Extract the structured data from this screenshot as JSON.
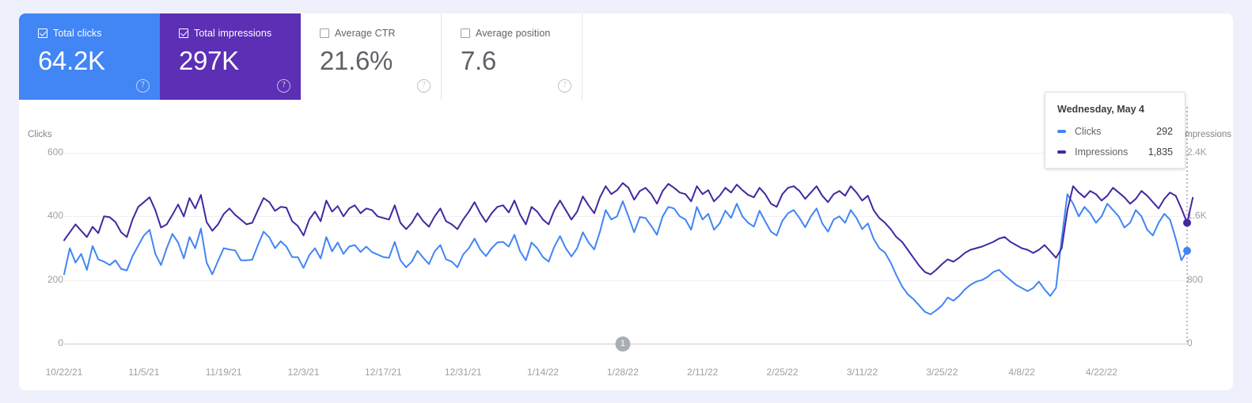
{
  "metrics": [
    {
      "id": "total-clicks",
      "label": "Total clicks",
      "value": "64.2K",
      "checked": true,
      "selected": "clicks",
      "help": "?"
    },
    {
      "id": "total-impressions",
      "label": "Total impressions",
      "value": "297K",
      "checked": true,
      "selected": "impr",
      "help": "?"
    },
    {
      "id": "average-ctr",
      "label": "Average CTR",
      "value": "21.6%",
      "checked": false,
      "selected": "",
      "help": "?"
    },
    {
      "id": "average-position",
      "label": "Average position",
      "value": "7.6",
      "checked": false,
      "selected": "",
      "help": "?"
    }
  ],
  "tooltip": {
    "title": "Wednesday, May 4",
    "rows": [
      {
        "name": "Clicks",
        "value": "292",
        "color": "#4285f4"
      },
      {
        "name": "Impressions",
        "value": "1,835",
        "color": "#4527a0"
      }
    ]
  },
  "colors": {
    "clicks": "#4285f4",
    "impressions": "#4527a0",
    "card_bg": "#ffffff",
    "page_bg": "#eef1fb",
    "grid": "#f0f0f2",
    "axis_text": "#9aa0a6"
  },
  "annotation": {
    "label": "1",
    "x_index": 98
  },
  "chart_data": {
    "type": "line",
    "title": "",
    "xlabel": "",
    "grid": true,
    "legend": "tooltip",
    "axes": {
      "left": {
        "label": "Clicks",
        "ticks": [
          "600",
          "400",
          "200",
          "0"
        ],
        "range": [
          0,
          600
        ]
      },
      "right": {
        "label": "Impressions",
        "ticks": [
          "2.4K",
          "1.6K",
          "800",
          "0"
        ],
        "range": [
          0,
          2400
        ]
      }
    },
    "x_tick_labels": [
      "10/22/21",
      "11/5/21",
      "11/19/21",
      "12/3/21",
      "12/17/21",
      "12/31/21",
      "1/14/22",
      "1/28/22",
      "2/11/22",
      "2/25/22",
      "3/11/22",
      "3/25/22",
      "4/8/22",
      "4/22/22"
    ],
    "x_tick_interval_days": 14,
    "x_start": "10/22/21",
    "x_end": "5/4/22",
    "n_points": 195,
    "series": [
      {
        "name": "Clicks",
        "axis": "left",
        "color": "#4285f4",
        "values": [
          218,
          300,
          255,
          282,
          232,
          307,
          265,
          258,
          247,
          262,
          235,
          230,
          275,
          308,
          340,
          358,
          282,
          247,
          300,
          345,
          318,
          268,
          335,
          300,
          362,
          255,
          218,
          260,
          300,
          296,
          293,
          262,
          262,
          264,
          310,
          352,
          334,
          300,
          322,
          305,
          272,
          272,
          238,
          278,
          300,
          268,
          335,
          290,
          318,
          282,
          305,
          310,
          288,
          305,
          288,
          280,
          272,
          270,
          320,
          262,
          240,
          258,
          292,
          270,
          250,
          290,
          310,
          265,
          258,
          240,
          280,
          300,
          330,
          296,
          275,
          300,
          318,
          320,
          305,
          342,
          290,
          262,
          318,
          300,
          272,
          258,
          305,
          338,
          300,
          274,
          300,
          350,
          318,
          296,
          352,
          420,
          390,
          400,
          448,
          400,
          350,
          398,
          395,
          370,
          342,
          400,
          430,
          425,
          400,
          390,
          358,
          430,
          390,
          408,
          358,
          378,
          418,
          395,
          440,
          400,
          380,
          368,
          418,
          384,
          352,
          340,
          386,
          410,
          420,
          395,
          366,
          400,
          425,
          378,
          352,
          390,
          400,
          380,
          420,
          395,
          360,
          378,
          330,
          300,
          286,
          255,
          215,
          180,
          155,
          140,
          120,
          100,
          92,
          105,
          120,
          145,
          135,
          150,
          170,
          185,
          195,
          200,
          210,
          225,
          232,
          215,
          200,
          185,
          175,
          165,
          175,
          195,
          170,
          150,
          175,
          330,
          470,
          440,
          400,
          430,
          410,
          380,
          400,
          440,
          420,
          400,
          365,
          380,
          420,
          400,
          358,
          340,
          380,
          408,
          390,
          330,
          262,
          292
        ]
      },
      {
        "name": "Impressions",
        "axis": "right",
        "color": "#4527a0",
        "values": [
          1300,
          1400,
          1500,
          1420,
          1340,
          1470,
          1390,
          1600,
          1590,
          1530,
          1400,
          1340,
          1560,
          1720,
          1780,
          1840,
          1680,
          1460,
          1500,
          1620,
          1750,
          1600,
          1830,
          1700,
          1870,
          1530,
          1420,
          1500,
          1630,
          1700,
          1620,
          1560,
          1500,
          1520,
          1680,
          1830,
          1780,
          1670,
          1720,
          1710,
          1540,
          1480,
          1360,
          1560,
          1660,
          1540,
          1800,
          1660,
          1730,
          1600,
          1700,
          1740,
          1640,
          1700,
          1680,
          1600,
          1580,
          1560,
          1740,
          1520,
          1440,
          1520,
          1640,
          1540,
          1470,
          1600,
          1700,
          1540,
          1500,
          1440,
          1560,
          1660,
          1780,
          1640,
          1530,
          1640,
          1720,
          1740,
          1650,
          1800,
          1620,
          1500,
          1720,
          1660,
          1560,
          1500,
          1680,
          1800,
          1680,
          1560,
          1660,
          1850,
          1740,
          1640,
          1840,
          1980,
          1880,
          1930,
          2020,
          1960,
          1810,
          1920,
          1960,
          1880,
          1760,
          1920,
          2010,
          1960,
          1900,
          1880,
          1790,
          1980,
          1880,
          1930,
          1790,
          1860,
          1960,
          1900,
          2000,
          1930,
          1870,
          1840,
          1960,
          1880,
          1760,
          1720,
          1880,
          1960,
          1980,
          1920,
          1820,
          1900,
          1980,
          1860,
          1780,
          1880,
          1920,
          1860,
          1980,
          1900,
          1800,
          1860,
          1680,
          1580,
          1520,
          1440,
          1340,
          1280,
          1180,
          1080,
          980,
          900,
          870,
          930,
          1000,
          1060,
          1030,
          1080,
          1140,
          1180,
          1200,
          1220,
          1250,
          1280,
          1320,
          1340,
          1280,
          1240,
          1200,
          1180,
          1140,
          1180,
          1240,
          1160,
          1080,
          1200,
          1680,
          1980,
          1900,
          1840,
          1920,
          1880,
          1800,
          1860,
          1960,
          1900,
          1840,
          1760,
          1820,
          1920,
          1860,
          1780,
          1700,
          1820,
          1900,
          1860,
          1700,
          1520,
          1835
        ]
      }
    ]
  }
}
